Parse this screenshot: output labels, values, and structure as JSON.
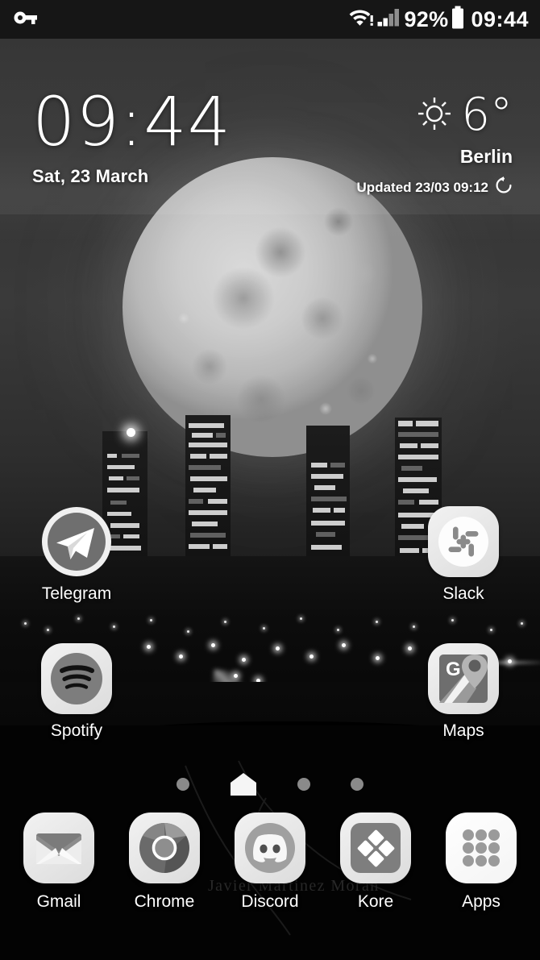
{
  "statusbar": {
    "vpn_icon": "key-icon",
    "wifi_icon": "wifi-no-internet-icon",
    "signal_icon": "cellular-signal-icon",
    "battery_percent": "92%",
    "battery_icon": "battery-icon",
    "time": "09:44"
  },
  "clock_widget": {
    "time": "09:44",
    "date": "Sat, 23 March"
  },
  "weather_widget": {
    "condition_icon": "sun-icon",
    "temperature": "6°",
    "city": "Berlin",
    "updated": "Updated 23/03 09:12",
    "refresh_icon": "refresh-icon"
  },
  "apps": [
    {
      "label": "Telegram",
      "icon": "telegram-icon"
    },
    {
      "label": "Slack",
      "icon": "slack-icon"
    },
    {
      "label": "Spotify",
      "icon": "spotify-icon"
    },
    {
      "label": "Maps",
      "icon": "google-maps-icon"
    }
  ],
  "page_indicator": {
    "pages": 4,
    "current": 1,
    "home_icon": "home-icon"
  },
  "dock": [
    {
      "label": "Gmail",
      "icon": "gmail-icon"
    },
    {
      "label": "Chrome",
      "icon": "chrome-icon"
    },
    {
      "label": "Discord",
      "icon": "discord-icon"
    },
    {
      "label": "Kore",
      "icon": "kore-icon"
    },
    {
      "label": "Apps",
      "icon": "apps-grid-icon"
    }
  ],
  "wallpaper": {
    "watermark": "Javier Martinez Moran",
    "description": "grayscale night cityscape with large full moon"
  },
  "colors": {
    "status_bar_bg": "#141414",
    "text_primary": "#ffffff",
    "icon_tile_light": "#ededed",
    "icon_gray": "#808080",
    "page_dot": "#8a8a8a"
  }
}
